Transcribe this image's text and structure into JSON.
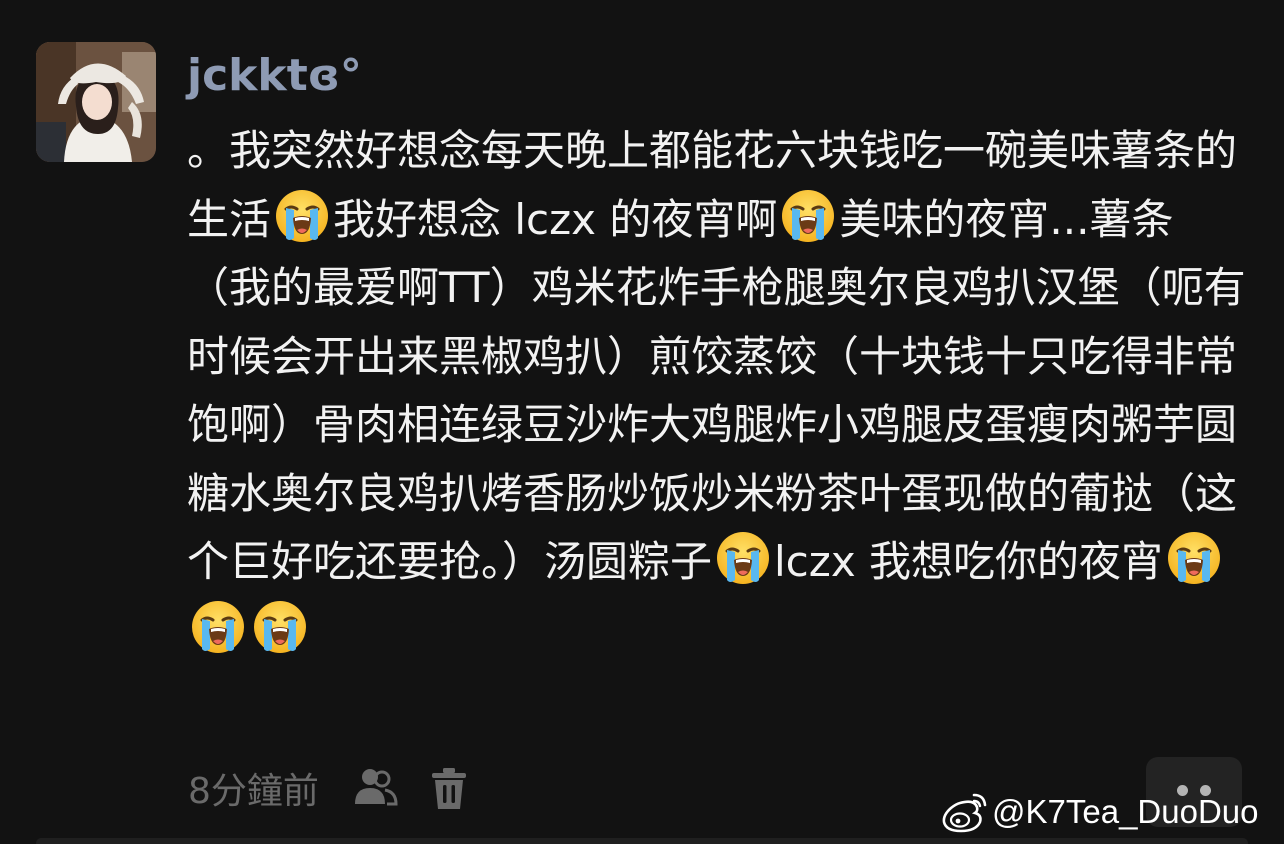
{
  "comment": {
    "author": "jckktɞ°",
    "segments": [
      {
        "type": "text",
        "value": "。我突然好想念每天晚上都能花六块钱吃一碗美味薯条的生活"
      },
      {
        "type": "emoji",
        "icon": "loudly-crying-face-icon"
      },
      {
        "type": "text",
        "value": "我好想念 lczx 的夜宵啊"
      },
      {
        "type": "emoji",
        "icon": "loudly-crying-face-icon"
      },
      {
        "type": "text",
        "value": "美味的夜宵...薯条（我的最爱啊TT）鸡米花炸手枪腿奥尔良鸡扒汉堡（呃有时候会开出来黑椒鸡扒）煎饺蒸饺（十块钱十只吃得非常饱啊）骨肉相连绿豆沙炸大鸡腿炸小鸡腿皮蛋瘦肉粥芋圆糖水奥尔良鸡扒烤香肠炒饭炒米粉茶叶蛋现做的葡挞（这个巨好吃还要抢。）汤圆粽子"
      },
      {
        "type": "emoji",
        "icon": "loudly-crying-face-icon"
      },
      {
        "type": "text",
        "value": "lczx 我想吃你的夜宵"
      },
      {
        "type": "emoji",
        "icon": "loudly-crying-face-icon"
      },
      {
        "type": "emoji",
        "icon": "loudly-crying-face-icon"
      },
      {
        "type": "emoji",
        "icon": "loudly-crying-face-icon"
      }
    ],
    "timestamp": "8分鐘前",
    "actions": {
      "visibility_icon": "people-icon",
      "delete_icon": "trash-icon",
      "more_icon": "more-dots-icon"
    }
  },
  "watermark": {
    "logo_icon": "weibo-icon",
    "text": "@K7Tea_DuoDuo"
  },
  "colors": {
    "background": "#121212",
    "username": "#8e9bb4",
    "body_text": "#f2f2f2",
    "meta_text": "#6a6a6a",
    "more_button_bg": "#232323"
  }
}
